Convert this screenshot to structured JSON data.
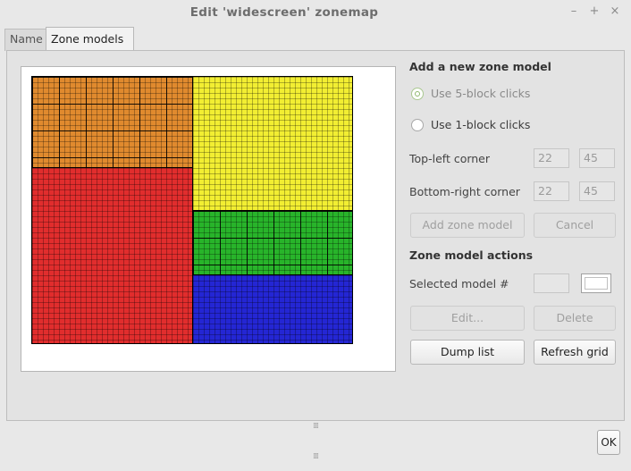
{
  "window": {
    "title": "Edit 'widescreen' zonemap",
    "controls": {
      "minimize": "–",
      "maximize": "+",
      "close": "×"
    }
  },
  "tabs": [
    {
      "label": "Name",
      "active": false
    },
    {
      "label": "Zone models",
      "active": true
    }
  ],
  "zone_grid": {
    "cols": 60,
    "rows": 50,
    "zones": [
      {
        "name": "orange",
        "color": "#e08a2e",
        "block": 5
      },
      {
        "name": "yellow",
        "color": "#f2ee32",
        "block": 1
      },
      {
        "name": "red",
        "color": "#e12d2d",
        "block": 1
      },
      {
        "name": "green",
        "color": "#28b42a",
        "block": 5
      },
      {
        "name": "blue",
        "color": "#2426d4",
        "block": 1
      }
    ]
  },
  "add_section": {
    "title": "Add a new zone model",
    "radio_5": "Use 5-block clicks",
    "radio_1": "Use 1-block clicks",
    "top_left_label": "Top-left corner",
    "top_left_x": "22",
    "top_left_y": "45",
    "bottom_right_label": "Bottom-right corner",
    "bottom_right_x": "22",
    "bottom_right_y": "45",
    "add_button": "Add zone model",
    "cancel_button": "Cancel"
  },
  "actions_section": {
    "title": "Zone model actions",
    "selected_label": "Selected model #",
    "edit_button": "Edit...",
    "delete_button": "Delete",
    "dump_button": "Dump list",
    "refresh_button": "Refresh grid"
  },
  "grips": {
    "upper": "⁞⁞⁞",
    "lower": "⁞⁞⁞"
  },
  "ok_button": "OK"
}
